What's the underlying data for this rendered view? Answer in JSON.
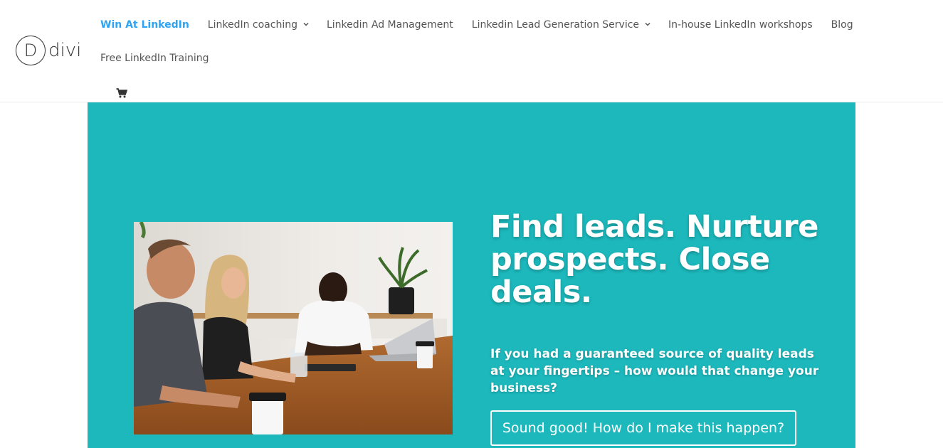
{
  "logo": {
    "mark": "D",
    "text": "divi"
  },
  "nav": {
    "items": [
      {
        "label": "Win At LinkedIn",
        "active": true,
        "dropdown": false
      },
      {
        "label": "LinkedIn coaching",
        "active": false,
        "dropdown": true
      },
      {
        "label": "Linkedin Ad Management",
        "active": false,
        "dropdown": false
      },
      {
        "label": "Linkedin Lead Generation Service",
        "active": false,
        "dropdown": true
      },
      {
        "label": "In-house LinkedIn workshops",
        "active": false,
        "dropdown": false
      },
      {
        "label": "Blog",
        "active": false,
        "dropdown": false
      },
      {
        "label": "Free LinkedIn Training",
        "active": false,
        "dropdown": false
      }
    ],
    "cart_icon": "shopping-cart-icon"
  },
  "hero": {
    "headline": "Find leads. Nurture prospects. Close deals.",
    "subtext": "If you had a guaranteed source of quality leads at your fingertips – how would that change your business?",
    "cta_label": "Sound good! How do I make this happen?",
    "background_color": "#1cb8bc"
  },
  "colors": {
    "accent": "#2ea3f2",
    "nav_text": "#555555",
    "hero_bg": "#1cb8bc"
  }
}
